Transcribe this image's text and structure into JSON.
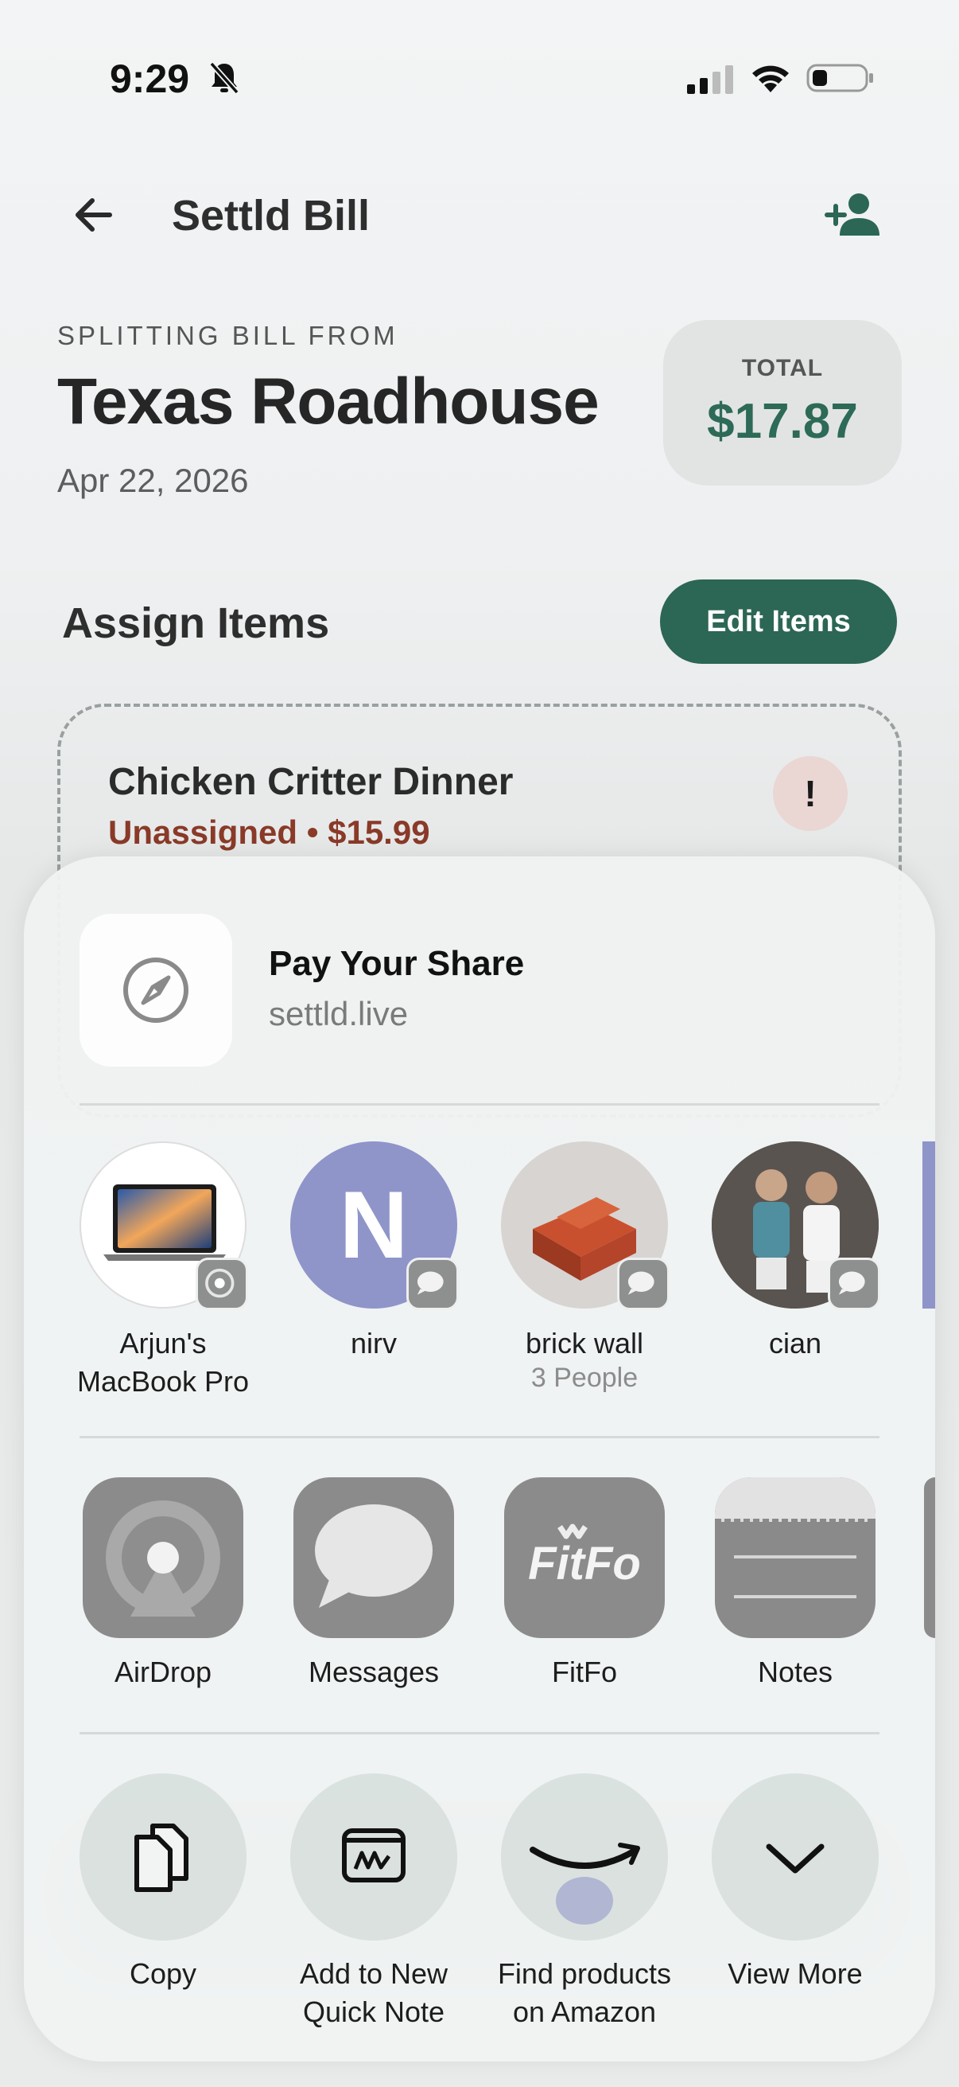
{
  "status_bar": {
    "time": "9:29",
    "icons": [
      "bell-slash-icon",
      "cellular-signal-icon",
      "wifi-icon",
      "battery-icon"
    ]
  },
  "header": {
    "title": "Settld Bill",
    "back_icon": "arrow-left-icon",
    "add_person_icon": "person-add-icon"
  },
  "bill": {
    "eyebrow": "SPLITTING BILL FROM",
    "restaurant": "Texas Roadhouse",
    "date": "Apr 22, 2026",
    "total_label": "TOTAL",
    "total_amount": "$17.87"
  },
  "assign": {
    "title": "Assign Items",
    "edit_button": "Edit Items"
  },
  "items": [
    {
      "name": "Chicken Critter Dinner",
      "status": "Unassigned • $15.99",
      "badge": "!"
    }
  ],
  "share_sheet": {
    "preview": {
      "title": "Pay Your Share",
      "url": "settld.live",
      "icon": "compass-icon"
    },
    "people": [
      {
        "name": "Arjun's\nMacBook Pro",
        "badge_icon": "airdrop-icon"
      },
      {
        "name": "nirv",
        "initial": "N",
        "badge_icon": "message-icon"
      },
      {
        "name": "brick wall",
        "subtitle": "3 People",
        "badge_icon": "message-icon"
      },
      {
        "name": "cian",
        "badge_icon": "message-icon"
      }
    ],
    "apps": [
      {
        "label": "AirDrop",
        "icon": "airdrop-icon"
      },
      {
        "label": "Messages",
        "icon": "messages-icon"
      },
      {
        "label": "FitFo",
        "icon": "fitfo-icon",
        "logo_text": "FitFo"
      },
      {
        "label": "Notes",
        "icon": "notes-icon"
      }
    ],
    "actions": [
      {
        "label": "Copy",
        "icon": "copy-icon"
      },
      {
        "label": "Add to New\nQuick Note",
        "icon": "quick-note-icon"
      },
      {
        "label": "Find products\non Amazon",
        "icon": "amazon-icon"
      },
      {
        "label": "View More",
        "icon": "chevron-down-icon"
      }
    ]
  },
  "colors": {
    "accent": "#2c6654",
    "total_text": "#2d6a57",
    "unassigned": "#8a3a28",
    "nirv_avatar": "#8f94c9"
  }
}
